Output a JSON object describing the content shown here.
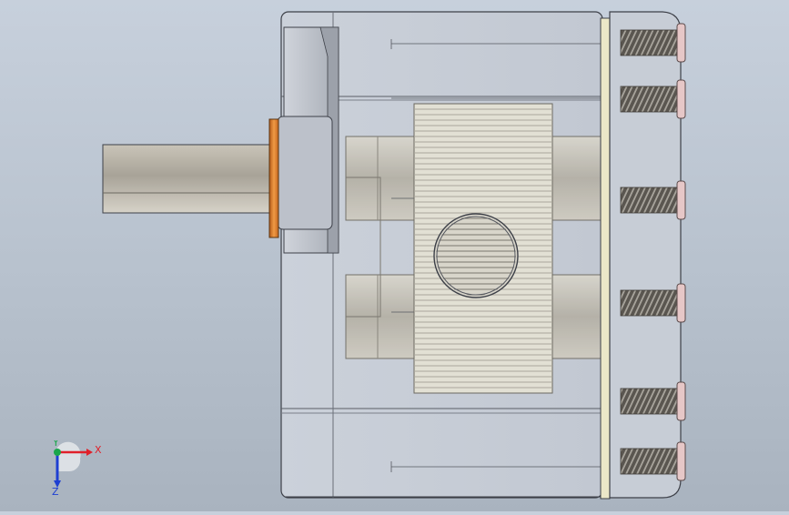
{
  "view": {
    "type": "3d-model-viewport",
    "model": "gear-pump",
    "background": [
      "#c7d0dc",
      "#a9b3bf"
    ]
  },
  "triad": {
    "x_label": "X",
    "y_label": "Y",
    "z_label": "Z",
    "colors": {
      "x": "#e0202a",
      "y": "#1aa64a",
      "z": "#1e3fd2"
    }
  },
  "model_colors": {
    "housing": "#c9cfd8",
    "edge": "#3d4048",
    "shaft": "#bdb8ad",
    "gear": "#e3e1d6",
    "washer": "#d87c2c",
    "gasket": "#e9e6c8",
    "bolt_head": "#e6c7c7",
    "bolt_thread": "#6a6660"
  }
}
